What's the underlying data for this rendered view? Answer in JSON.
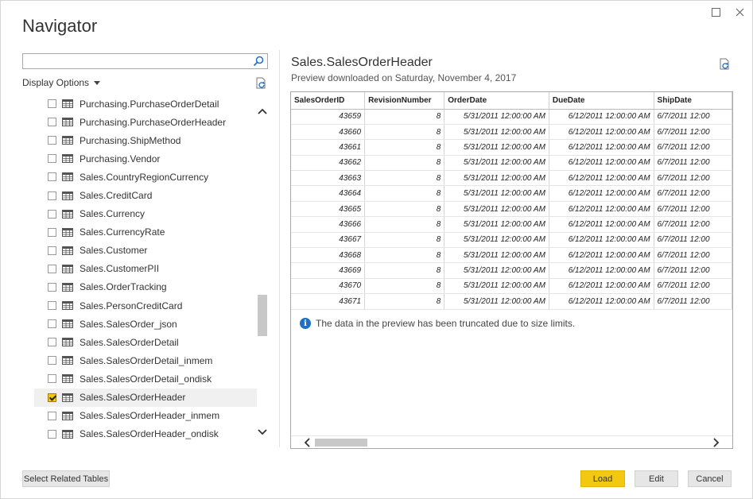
{
  "window": {
    "title": "Navigator",
    "maximize_glyph": "☐",
    "close_glyph": "✕"
  },
  "left_pane": {
    "search": {
      "value": "",
      "placeholder": "",
      "icon": "search-icon"
    },
    "display_options_label": "Display Options",
    "items": [
      {
        "label": "Purchasing.PurchaseOrderDetail",
        "checked": false
      },
      {
        "label": "Purchasing.PurchaseOrderHeader",
        "checked": false
      },
      {
        "label": "Purchasing.ShipMethod",
        "checked": false
      },
      {
        "label": "Purchasing.Vendor",
        "checked": false
      },
      {
        "label": "Sales.CountryRegionCurrency",
        "checked": false
      },
      {
        "label": "Sales.CreditCard",
        "checked": false
      },
      {
        "label": "Sales.Currency",
        "checked": false
      },
      {
        "label": "Sales.CurrencyRate",
        "checked": false
      },
      {
        "label": "Sales.Customer",
        "checked": false
      },
      {
        "label": "Sales.CustomerPII",
        "checked": false
      },
      {
        "label": "Sales.OrderTracking",
        "checked": false
      },
      {
        "label": "Sales.PersonCreditCard",
        "checked": false
      },
      {
        "label": "Sales.SalesOrder_json",
        "checked": false
      },
      {
        "label": "Sales.SalesOrderDetail",
        "checked": false
      },
      {
        "label": "Sales.SalesOrderDetail_inmem",
        "checked": false
      },
      {
        "label": "Sales.SalesOrderDetail_ondisk",
        "checked": false
      },
      {
        "label": "Sales.SalesOrderHeader",
        "checked": true
      },
      {
        "label": "Sales.SalesOrderHeader_inmem",
        "checked": false
      },
      {
        "label": "Sales.SalesOrderHeader_ondisk",
        "checked": false
      }
    ]
  },
  "preview": {
    "title": "Sales.SalesOrderHeader",
    "subtitle": "Preview downloaded on Saturday, November 4, 2017",
    "columns": [
      "SalesOrderID",
      "RevisionNumber",
      "OrderDate",
      "DueDate",
      "ShipDate"
    ],
    "rows": [
      [
        "43659",
        "8",
        "5/31/2011 12:00:00 AM",
        "6/12/2011 12:00:00 AM",
        "6/7/2011 12:00"
      ],
      [
        "43660",
        "8",
        "5/31/2011 12:00:00 AM",
        "6/12/2011 12:00:00 AM",
        "6/7/2011 12:00"
      ],
      [
        "43661",
        "8",
        "5/31/2011 12:00:00 AM",
        "6/12/2011 12:00:00 AM",
        "6/7/2011 12:00"
      ],
      [
        "43662",
        "8",
        "5/31/2011 12:00:00 AM",
        "6/12/2011 12:00:00 AM",
        "6/7/2011 12:00"
      ],
      [
        "43663",
        "8",
        "5/31/2011 12:00:00 AM",
        "6/12/2011 12:00:00 AM",
        "6/7/2011 12:00"
      ],
      [
        "43664",
        "8",
        "5/31/2011 12:00:00 AM",
        "6/12/2011 12:00:00 AM",
        "6/7/2011 12:00"
      ],
      [
        "43665",
        "8",
        "5/31/2011 12:00:00 AM",
        "6/12/2011 12:00:00 AM",
        "6/7/2011 12:00"
      ],
      [
        "43666",
        "8",
        "5/31/2011 12:00:00 AM",
        "6/12/2011 12:00:00 AM",
        "6/7/2011 12:00"
      ],
      [
        "43667",
        "8",
        "5/31/2011 12:00:00 AM",
        "6/12/2011 12:00:00 AM",
        "6/7/2011 12:00"
      ],
      [
        "43668",
        "8",
        "5/31/2011 12:00:00 AM",
        "6/12/2011 12:00:00 AM",
        "6/7/2011 12:00"
      ],
      [
        "43669",
        "8",
        "5/31/2011 12:00:00 AM",
        "6/12/2011 12:00:00 AM",
        "6/7/2011 12:00"
      ],
      [
        "43670",
        "8",
        "5/31/2011 12:00:00 AM",
        "6/12/2011 12:00:00 AM",
        "6/7/2011 12:00"
      ],
      [
        "43671",
        "8",
        "5/31/2011 12:00:00 AM",
        "6/12/2011 12:00:00 AM",
        "6/7/2011 12:00"
      ]
    ],
    "truncation_notice": "The data in the preview has been truncated due to size limits.",
    "info_glyph": "i"
  },
  "buttons": {
    "select_related": "Select Related Tables",
    "load": "Load",
    "edit": "Edit",
    "cancel": "Cancel"
  },
  "colors": {
    "accent_yellow": "#f2c811",
    "info_blue": "#1f6fc5"
  }
}
